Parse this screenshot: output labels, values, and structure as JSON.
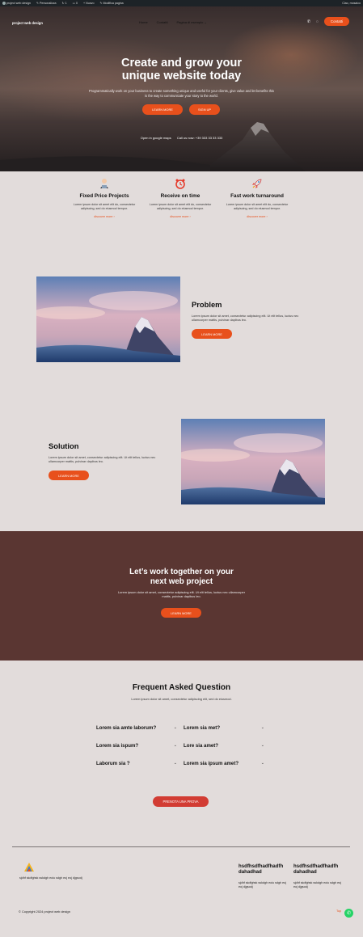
{
  "admin_bar": {
    "site": "project web design",
    "customize": "Personalizza",
    "updates": "1",
    "comments": "0",
    "new": "Nuovo",
    "edit": "Modifica pagina",
    "greeting": "Ciao, mosaico"
  },
  "nav": {
    "logo": "project web design",
    "links": [
      "Home",
      "Contatti",
      "Pagina di esempio"
    ],
    "contact_button": "Contatti"
  },
  "hero": {
    "title_line1": "Create and grow your",
    "title_line2": "unique website today",
    "subtitle": "Programmatically work on your business to create something unique and useful for your clients, give value and let benefits this is the way to communicate your story to the world.",
    "btn_learn": "LEARN MORE",
    "btn_signup": "SIGN UP",
    "map_link": "Open in google maps",
    "call": "Call us now: +39 333 33 33 333"
  },
  "features": [
    {
      "icon": "user-icon",
      "title": "Fixed Price Projects",
      "text": "Lorem ipsum dolor sit amet elit do, consectetur adipiscing, sed do eiusmod tempor.",
      "link": "discover more ›"
    },
    {
      "icon": "clock-icon",
      "title": "Receive on time",
      "text": "Lorem ipsum dolor sit amet elit do, consectetur adipiscing, sed do eiusmod tempor.",
      "link": "discover more ›"
    },
    {
      "icon": "rocket-icon",
      "title": "Fast work turnaround",
      "text": "Lorem ipsum dolor sit amet elit do, consectetur adipiscing, sed do eiusmod tempor.",
      "link": "discover more ›"
    }
  ],
  "problem": {
    "title": "Problem",
    "text": "Lorem ipsum dolor sit amet, consectetur adipiscing elit. Ut elit tellus, luctus nec ullamcorper mattis, pulvinar dapibus leo.",
    "button": "LEARN MORE"
  },
  "solution": {
    "title": "Solution",
    "text": "Lorem ipsum dolor sit amet, consectetur adipiscing elit. Ut elit tellus, luctus nec ullamcorper mattis, pulvinar dapibus leo.",
    "button": "LEARN MORE"
  },
  "cta": {
    "title_line1": "Let’s work together on your",
    "title_line2": "next web project",
    "text": "Lorem ipsum dolor sit amet, consectetur adipiscing elit. Ut elit tellus, luctus nec ullamcorper mattis, pulvinar dapibus leo.",
    "button": "LEARN MORE"
  },
  "faq": {
    "title": "Frequent Asked Question",
    "subtitle": "Lorem ipsum dolor sit amet, consectetur adipiscing elit, sed do eiusmod.",
    "items": [
      "Lorem sia amte laborum?",
      "Lorem sia met?",
      "Lorem sia ispum?",
      "Lore sia amet?",
      "Laborum sia ?",
      "Lorem sia ipsum amet?"
    ],
    "button": "PRENOTA UNA PROVA"
  },
  "footer": {
    "about": "sjdhf skdfghsk sskdgh eoiu sdgh eoj eoj djgsodj",
    "col1_title": "hsdfhsdfhadfhadfh dahadhad",
    "col1_text": "sjdhf skdfghsk sskdgh eoiu sdgh eoj eoj djgsodj",
    "col2_title": "hsdfhsdfhadfhadfh dahadhad",
    "col2_text": "sjdhf skdfghsk sskdgh eoiu sdgh eoj eoj djgsodj",
    "copyright": "© Copyright 2024 project web design",
    "top": "Top"
  },
  "colors": {
    "accent": "#e8501c",
    "cta_bg": "#5a3632",
    "page_bg": "#e2dcdb",
    "faq_button": "#d23c33"
  }
}
